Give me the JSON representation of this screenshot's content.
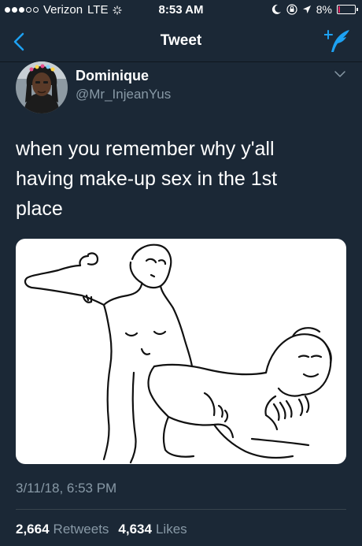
{
  "status_bar": {
    "carrier": "Verizon",
    "network": "LTE",
    "time": "8:53 AM",
    "battery_percent": "8%",
    "signal_bars_filled": 3,
    "signal_bars_total": 5
  },
  "nav": {
    "title": "Tweet",
    "back_icon": "chevron-left-icon",
    "compose_icon": "compose-tweet-icon",
    "accent_color": "#1da1f2"
  },
  "tweet": {
    "display_name": "Dominique",
    "handle": "@Mr_InjeanYus",
    "text": "when you remember why y'all\nhaving make-up sex in the 1st\nplace",
    "timestamp": "3/11/18, 6:53 PM",
    "retweets_count": "2,664",
    "retweets_label": "Retweets",
    "likes_count": "4,634",
    "likes_label": "Likes"
  },
  "colors": {
    "background": "#1b2836",
    "text_primary": "#ffffff",
    "text_secondary": "#8899a6",
    "divider": "#38444d"
  }
}
